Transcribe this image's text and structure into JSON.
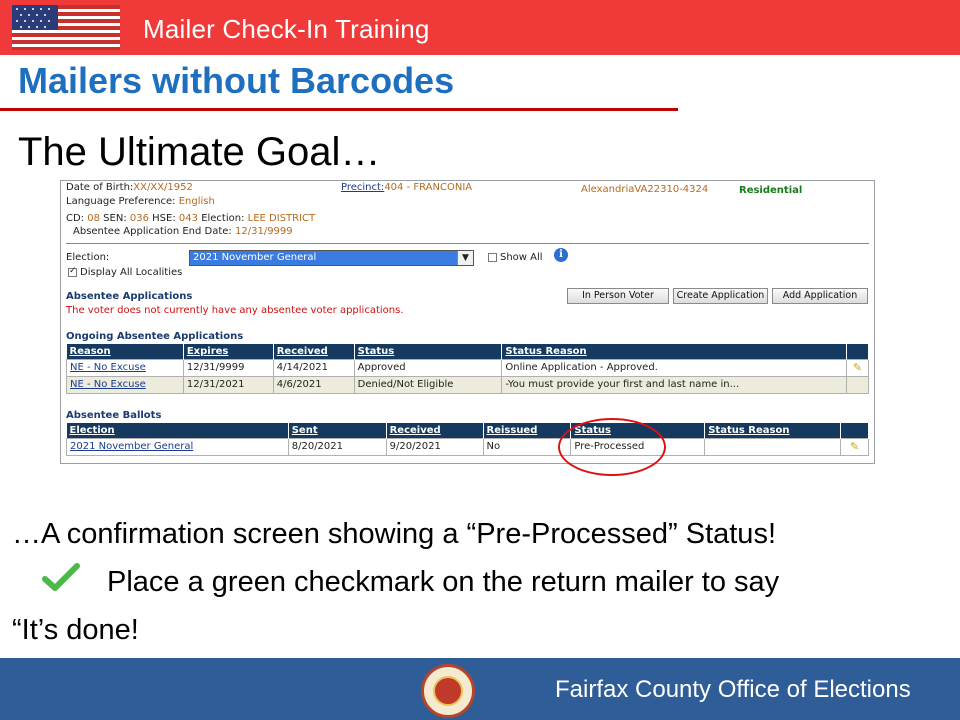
{
  "banner": {
    "title": "Mailer Check-In Training"
  },
  "slide": {
    "title": "Mailers without Barcodes",
    "subtitle": "The Ultimate Goal…",
    "line1": "…A confirmation screen showing a “Pre-Processed” Status!",
    "line2": "Place a green checkmark on the return mailer to say",
    "line3": "“It’s done!"
  },
  "voter": {
    "dob_label": "Date of Birth:",
    "dob_value": "XX/XX/1952",
    "precinct_label": "Precinct:",
    "precinct_value": "404 - FRANCONIA",
    "address": "AlexandriaVA22310-4324",
    "residential": "Residential",
    "lang_label": "Language Preference:",
    "lang_value": "English",
    "cd_label": "CD:",
    "cd_value": "08",
    "sen_label": "SEN:",
    "sen_value": "036",
    "hse_label": "HSE:",
    "hse_value": "043",
    "election_label": "Election:",
    "election_value": "LEE DISTRICT",
    "abs_end_label": "Absentee Application End Date:",
    "abs_end_value": "12/31/9999"
  },
  "filters": {
    "election_label": "Election:",
    "election_selected": "2021 November General",
    "show_all": "Show All",
    "display_all": "Display All Localities"
  },
  "applications": {
    "heading": "Absentee Applications",
    "none_msg": "The voter does not currently have any absentee voter applications.",
    "buttons": [
      "In Person Voter",
      "Create Application",
      "Add Application"
    ]
  },
  "ongoing": {
    "heading": "Ongoing Absentee Applications",
    "columns": [
      "Reason",
      "Expires",
      "Received",
      "Status",
      "Status Reason"
    ],
    "rows": [
      [
        "NE - No Excuse",
        "12/31/9999",
        "4/14/2021",
        "Approved",
        "Online Application - Approved."
      ],
      [
        "NE - No Excuse",
        "12/31/2021",
        "4/6/2021",
        "Denied/Not Eligible",
        "-You must provide your first and last name in..."
      ]
    ]
  },
  "ballots": {
    "heading": "Absentee Ballots",
    "columns": [
      "Election",
      "Sent",
      "Received",
      "Reissued",
      "Status",
      "Status Reason"
    ],
    "rows": [
      [
        "2021 November General",
        "8/20/2021",
        "9/20/2021",
        "No",
        "Pre-Processed",
        ""
      ]
    ]
  },
  "footer": {
    "org": "Fairfax County Office of Elections"
  },
  "colors": {
    "banner": "#f03a3a",
    "title_blue": "#1f6fbf",
    "footer": "#2f5d97",
    "highlight_circle": "#d11111"
  },
  "icons": [
    "us-flag-icon",
    "info-icon",
    "pencil-icon",
    "green-checkmark-icon",
    "county-seal-icon"
  ]
}
